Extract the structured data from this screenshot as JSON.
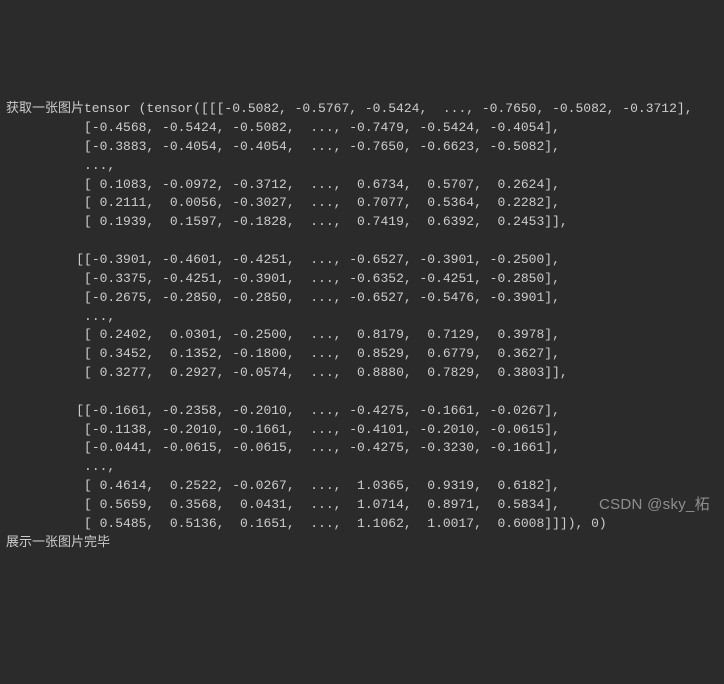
{
  "console": {
    "header": "获取一张图片tensor (tensor([[[-0.5082, -0.5767, -0.5424,  ..., -0.7650, -0.5082, -0.3712],",
    "lines": [
      "          [-0.4568, -0.5424, -0.5082,  ..., -0.7479, -0.5424, -0.4054],",
      "          [-0.3883, -0.4054, -0.4054,  ..., -0.7650, -0.6623, -0.5082],",
      "          ...,",
      "          [ 0.1083, -0.0972, -0.3712,  ...,  0.6734,  0.5707,  0.2624],",
      "          [ 0.2111,  0.0056, -0.3027,  ...,  0.7077,  0.5364,  0.2282],",
      "          [ 0.1939,  0.1597, -0.1828,  ...,  0.7419,  0.6392,  0.2453]],",
      "",
      "         [[-0.3901, -0.4601, -0.4251,  ..., -0.6527, -0.3901, -0.2500],",
      "          [-0.3375, -0.4251, -0.3901,  ..., -0.6352, -0.4251, -0.2850],",
      "          [-0.2675, -0.2850, -0.2850,  ..., -0.6527, -0.5476, -0.3901],",
      "          ...,",
      "          [ 0.2402,  0.0301, -0.2500,  ...,  0.8179,  0.7129,  0.3978],",
      "          [ 0.3452,  0.1352, -0.1800,  ...,  0.8529,  0.6779,  0.3627],",
      "          [ 0.3277,  0.2927, -0.0574,  ...,  0.8880,  0.7829,  0.3803]],",
      "",
      "         [[-0.1661, -0.2358, -0.2010,  ..., -0.4275, -0.1661, -0.0267],",
      "          [-0.1138, -0.2010, -0.1661,  ..., -0.4101, -0.2010, -0.0615],",
      "          [-0.0441, -0.0615, -0.0615,  ..., -0.4275, -0.3230, -0.1661],",
      "          ...,",
      "          [ 0.4614,  0.2522, -0.0267,  ...,  1.0365,  0.9319,  0.6182],",
      "          [ 0.5659,  0.3568,  0.0431,  ...,  1.0714,  0.8971,  0.5834],",
      "          [ 0.5485,  0.5136,  0.1651,  ...,  1.1062,  1.0017,  0.6008]]]), 0)"
    ],
    "footer": "展示一张图片完毕"
  },
  "watermark": "CSDN @sky_柘"
}
